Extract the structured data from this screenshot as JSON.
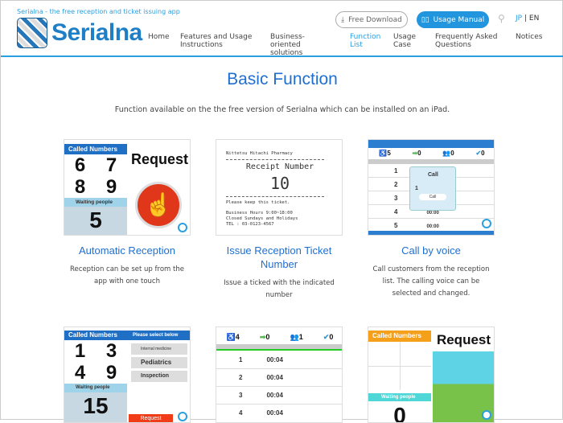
{
  "header": {
    "tagline": "Serialna - the free reception and ticket issuing app",
    "logo_text": "Serialna",
    "free_download": "Free Download",
    "usage_manual": "Usage Manual",
    "lang_jp": "JP",
    "lang_sep": "|",
    "lang_en": "EN",
    "nav": [
      {
        "label": "Home"
      },
      {
        "label": "Features and Usage Instructions"
      },
      {
        "label": "Business-oriented solutions"
      },
      {
        "label": "Function List",
        "active": true
      },
      {
        "label": "Usage Case"
      },
      {
        "label": "Frequently Asked Questions"
      },
      {
        "label": "Notices"
      }
    ],
    "accent": "#2a9fe0"
  },
  "main": {
    "title": "Basic Function",
    "subtitle": "Function available on the the free version of Serialna which can be installed on an iPad.",
    "cards": [
      {
        "title": "Automatic Reception",
        "desc": "Reception can be set up from the app with one touch",
        "shot": {
          "called": "Called Numbers",
          "nums": [
            "6",
            "7",
            "8",
            "9"
          ],
          "waiting": "Waiting people",
          "count": "5",
          "request": "Request"
        }
      },
      {
        "title": "Issue Reception Ticket Number",
        "desc": "Issue a ticked with the indicated number",
        "shot": {
          "store": "Nittetsu Hitachi Pharmacy",
          "heading": "Receipt Number",
          "number": "10",
          "keep": "Please keep this ticket.",
          "hours": "Business Hours 9:00~18:00",
          "closed": "Closed Sundays and Holidays",
          "tel": "TEL : 03-0123-4567"
        }
      },
      {
        "title": "Call by voice",
        "desc": "Call customers from the reception list. The calling voice can be selected and changed.",
        "shot": {
          "counts": [
            "5",
            "0",
            "0",
            "0"
          ],
          "rows": [
            "1",
            "2",
            "3",
            "4",
            "5"
          ],
          "times": [
            "",
            "",
            "",
            "00:00",
            "00:00"
          ],
          "popup": "Call",
          "popup_btn": "Call",
          "popup_num": "1"
        }
      },
      {
        "title": "",
        "desc": "",
        "shot": {
          "called": "Called Numbers",
          "select": "Please select below",
          "nums": [
            "1",
            "3",
            "4",
            "9"
          ],
          "options": [
            "Internal medicine",
            "Pediatrics",
            "Inspection"
          ],
          "waiting": "Waiting people",
          "count": "15",
          "request": "Request"
        }
      },
      {
        "title": "",
        "desc": "",
        "shot": {
          "counts": [
            "4",
            "0",
            "1",
            "0"
          ],
          "rows": [
            "1",
            "2",
            "3",
            "4"
          ],
          "time": "00:04"
        }
      },
      {
        "title": "",
        "desc": "",
        "shot": {
          "called": "Called Numbers",
          "waiting": "Waiting people",
          "count": "0",
          "request": "Request"
        }
      }
    ]
  }
}
